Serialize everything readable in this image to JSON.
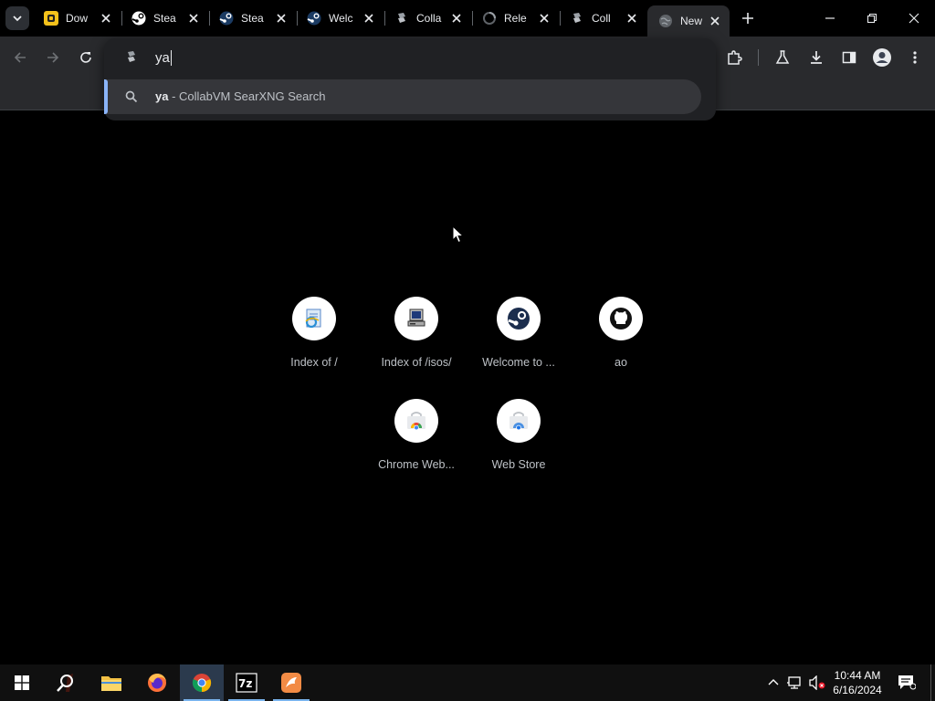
{
  "browser": {
    "tabs": [
      {
        "title": "Dow",
        "icon": "yellow-app-icon"
      },
      {
        "title": "Stea",
        "icon": "steam-icon"
      },
      {
        "title": "Stea",
        "icon": "steam-icon"
      },
      {
        "title": "Welc",
        "icon": "steam-icon"
      },
      {
        "title": "Colla",
        "icon": "collabvm-icon"
      },
      {
        "title": "Rele",
        "icon": "github-icon"
      },
      {
        "title": "Coll",
        "icon": "collabvm-icon"
      },
      {
        "title": "New",
        "icon": "globe-icon",
        "active": true
      }
    ]
  },
  "omnibox": {
    "query": "ya",
    "suggestion_query": "ya",
    "suggestion_rest": " - CollabVM SearXNG Search"
  },
  "shortcuts": [
    {
      "label": "Index of /",
      "icon": "ie-document-icon"
    },
    {
      "label": "Index of /isos/",
      "icon": "computer-icon"
    },
    {
      "label": "Welcome to ...",
      "icon": "steam-icon"
    },
    {
      "label": "ao",
      "icon": "github-icon"
    },
    {
      "label": "Chrome Web...",
      "icon": "chrome-web-store-icon"
    },
    {
      "label": "Web Store",
      "icon": "web-store-icon"
    }
  ],
  "taskbar": {
    "time": "10:44 AM",
    "date": "6/16/2024"
  },
  "colors": {
    "accent": "#8ab4f8",
    "toolbar": "#292a2d",
    "omnibox": "#202124"
  }
}
